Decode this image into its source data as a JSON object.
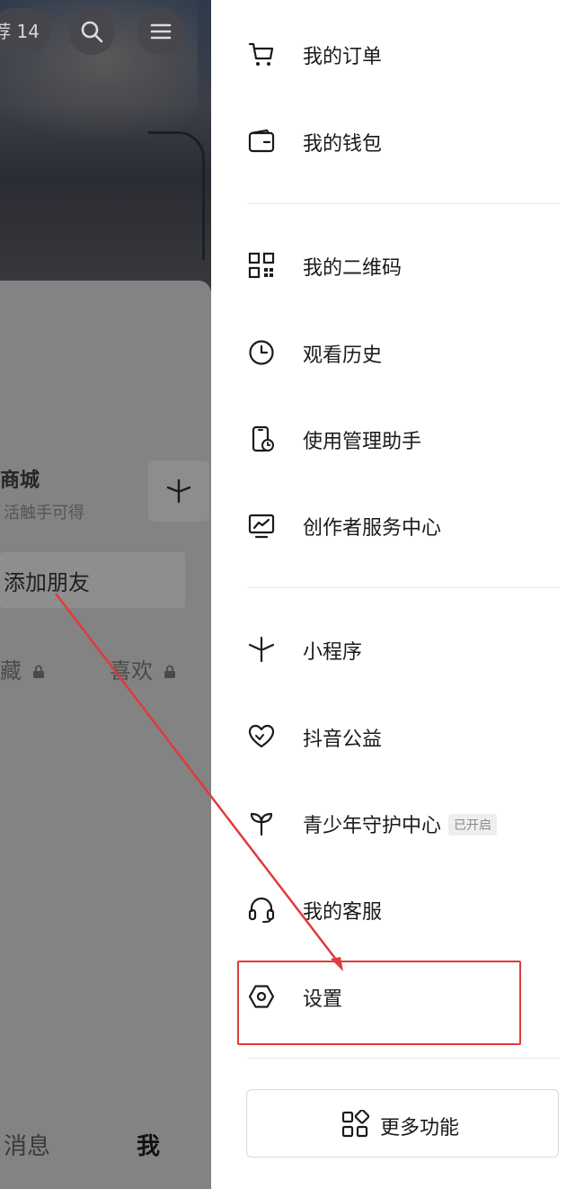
{
  "background": {
    "badge_text": "荐 14",
    "mall_title": "商城",
    "mall_subtitle": "活触手可得",
    "add_friend": "添加朋友",
    "tab_collect": "藏",
    "tab_like": "喜欢",
    "nav_messages": "消息",
    "nav_me": "我"
  },
  "menu": {
    "orders": "我的订单",
    "wallet": "我的钱包",
    "qrcode": "我的二维码",
    "history": "观看历史",
    "usage_manager": "使用管理助手",
    "creator_center": "创作者服务中心",
    "mini_programs": "小程序",
    "charity": "抖音公益",
    "youth_guard": "青少年守护中心",
    "youth_guard_badge": "已开启",
    "customer_service": "我的客服",
    "settings": "设置"
  },
  "more_button": "更多功能",
  "colors": {
    "highlight_box": "#e03a3a",
    "annotation_arrow": "#e03a3a",
    "dim_overlay": "#7a7a7a"
  }
}
